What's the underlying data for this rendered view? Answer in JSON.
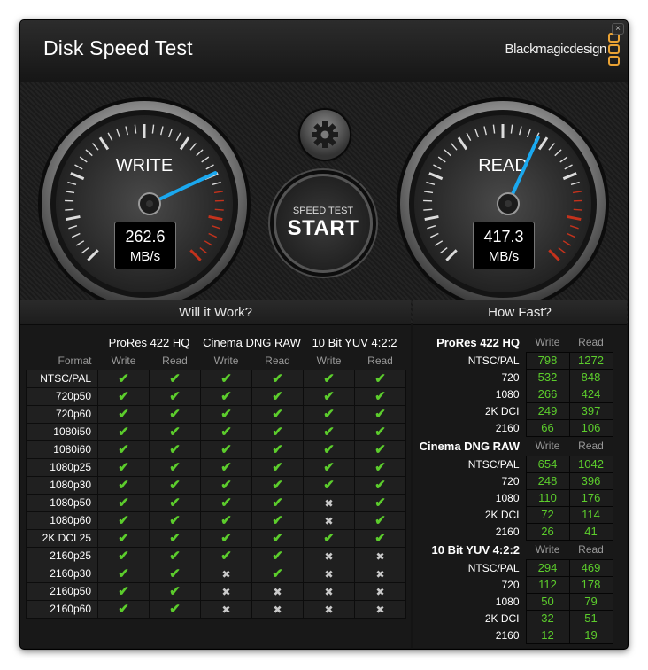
{
  "app": {
    "title": "Disk Speed Test",
    "brand": "Blackmagicdesign",
    "close_glyph": "×",
    "accent": "#e9a234"
  },
  "gauges": {
    "write": {
      "label": "WRITE",
      "value": "262.6",
      "unit": "MB/s",
      "needle_fraction": 0.26
    },
    "read": {
      "label": "READ",
      "value": "417.3",
      "unit": "MB/s",
      "needle_fraction": 0.41
    }
  },
  "controls": {
    "settings_icon": "gear-icon",
    "start_small": "SPEED TEST",
    "start_big": "START"
  },
  "will_it_work": {
    "title": "Will it Work?",
    "format_label": "Format",
    "groups": [
      "ProRes 422 HQ",
      "Cinema DNG RAW",
      "10 Bit YUV 4:2:2"
    ],
    "sub": [
      "Write",
      "Read"
    ],
    "rows": [
      {
        "name": "NTSC/PAL",
        "c": [
          1,
          1,
          1,
          1,
          1,
          1
        ]
      },
      {
        "name": "720p50",
        "c": [
          1,
          1,
          1,
          1,
          1,
          1
        ]
      },
      {
        "name": "720p60",
        "c": [
          1,
          1,
          1,
          1,
          1,
          1
        ]
      },
      {
        "name": "1080i50",
        "c": [
          1,
          1,
          1,
          1,
          1,
          1
        ]
      },
      {
        "name": "1080i60",
        "c": [
          1,
          1,
          1,
          1,
          1,
          1
        ]
      },
      {
        "name": "1080p25",
        "c": [
          1,
          1,
          1,
          1,
          1,
          1
        ]
      },
      {
        "name": "1080p30",
        "c": [
          1,
          1,
          1,
          1,
          1,
          1
        ]
      },
      {
        "name": "1080p50",
        "c": [
          1,
          1,
          1,
          1,
          0,
          1
        ]
      },
      {
        "name": "1080p60",
        "c": [
          1,
          1,
          1,
          1,
          0,
          1
        ]
      },
      {
        "name": "2K DCI 25",
        "c": [
          1,
          1,
          1,
          1,
          1,
          1
        ]
      },
      {
        "name": "2160p25",
        "c": [
          1,
          1,
          1,
          1,
          0,
          0
        ]
      },
      {
        "name": "2160p30",
        "c": [
          1,
          1,
          0,
          1,
          0,
          0
        ]
      },
      {
        "name": "2160p50",
        "c": [
          1,
          1,
          0,
          0,
          0,
          0
        ]
      },
      {
        "name": "2160p60",
        "c": [
          1,
          1,
          0,
          0,
          0,
          0
        ]
      }
    ]
  },
  "how_fast": {
    "title": "How Fast?",
    "sub": [
      "Write",
      "Read"
    ],
    "groups": [
      {
        "name": "ProRes 422 HQ",
        "rows": [
          {
            "name": "NTSC/PAL",
            "w": "798",
            "r": "1272"
          },
          {
            "name": "720",
            "w": "532",
            "r": "848"
          },
          {
            "name": "1080",
            "w": "266",
            "r": "424"
          },
          {
            "name": "2K DCI",
            "w": "249",
            "r": "397"
          },
          {
            "name": "2160",
            "w": "66",
            "r": "106"
          }
        ]
      },
      {
        "name": "Cinema DNG RAW",
        "rows": [
          {
            "name": "NTSC/PAL",
            "w": "654",
            "r": "1042"
          },
          {
            "name": "720",
            "w": "248",
            "r": "396"
          },
          {
            "name": "1080",
            "w": "110",
            "r": "176"
          },
          {
            "name": "2K DCI",
            "w": "72",
            "r": "114"
          },
          {
            "name": "2160",
            "w": "26",
            "r": "41"
          }
        ]
      },
      {
        "name": "10 Bit YUV 4:2:2",
        "rows": [
          {
            "name": "NTSC/PAL",
            "w": "294",
            "r": "469"
          },
          {
            "name": "720",
            "w": "112",
            "r": "178"
          },
          {
            "name": "1080",
            "w": "50",
            "r": "79"
          },
          {
            "name": "2K DCI",
            "w": "32",
            "r": "51"
          },
          {
            "name": "2160",
            "w": "12",
            "r": "19"
          }
        ]
      }
    ]
  },
  "symbols": {
    "check": "✔",
    "cross": "✖"
  }
}
